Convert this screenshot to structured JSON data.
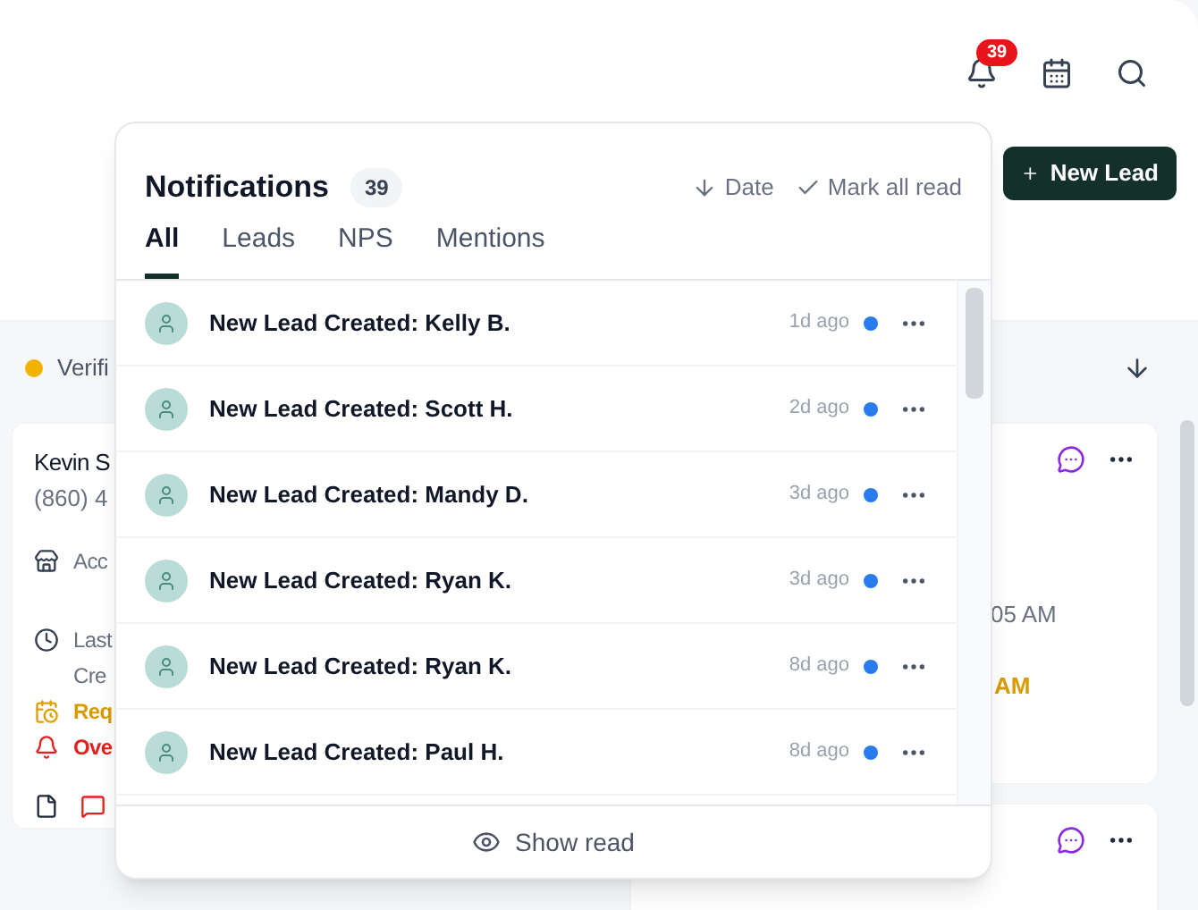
{
  "header": {
    "notification_badge": "39",
    "new_lead_button": "New Lead"
  },
  "board": {
    "column_header": {
      "label": "Verifi",
      "color": "#f2b200"
    },
    "card_1": {
      "name": "Kevin S",
      "phone": "(860) 4",
      "rows": [
        {
          "kind": "store",
          "text": "Acc"
        },
        {
          "kind": "clock",
          "text": "Last"
        },
        {
          "kind": "plain",
          "text": "Cre"
        },
        {
          "kind": "warning",
          "text": "Req"
        },
        {
          "kind": "alert",
          "text": "Ove"
        }
      ]
    },
    "card_2": {
      "time": "05 AM",
      "warning_time": "AM"
    }
  },
  "notifications": {
    "title": "Notifications",
    "count": "39",
    "sort_label": "Date",
    "mark_all_read": "Mark all read",
    "tabs": [
      {
        "label": "All",
        "selected": true
      },
      {
        "label": "Leads",
        "selected": false
      },
      {
        "label": "NPS",
        "selected": false
      },
      {
        "label": "Mentions",
        "selected": false
      }
    ],
    "items": [
      {
        "title": "New Lead Created: Kelly B.",
        "time": "1d ago",
        "unread": true
      },
      {
        "title": "New Lead Created: Scott H.",
        "time": "2d ago",
        "unread": true
      },
      {
        "title": "New Lead Created: Mandy D.",
        "time": "3d ago",
        "unread": true
      },
      {
        "title": "New Lead Created: Ryan K.",
        "time": "3d ago",
        "unread": true
      },
      {
        "title": "New Lead Created: Ryan K.",
        "time": "8d ago",
        "unread": true
      },
      {
        "title": "New Lead Created: Paul H.",
        "time": "8d ago",
        "unread": true
      }
    ],
    "footer_button": "Show read"
  }
}
